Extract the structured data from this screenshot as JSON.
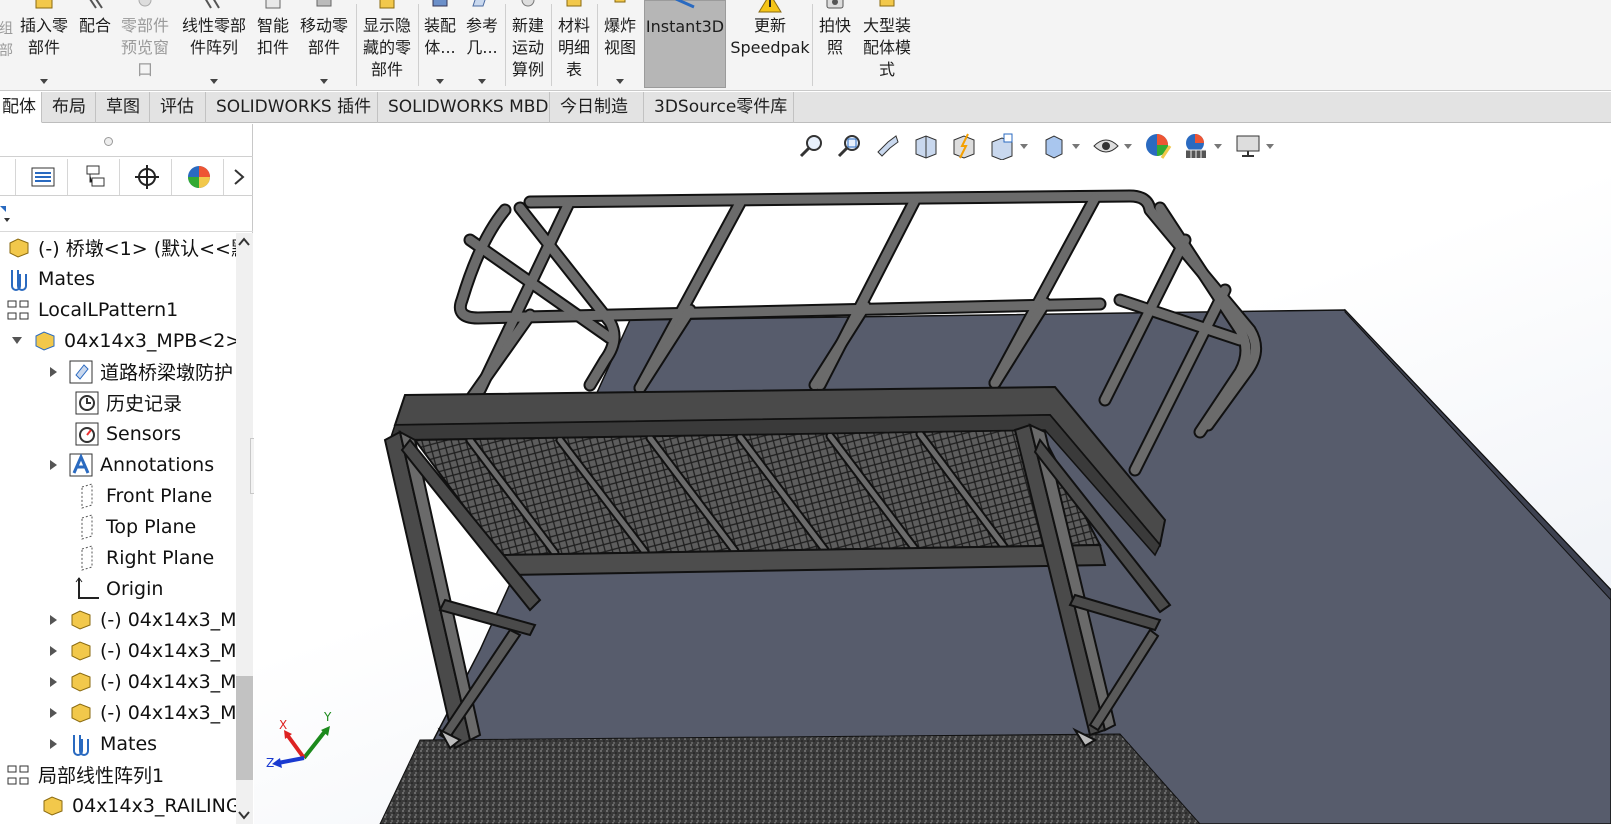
{
  "ribbon": {
    "buttons": [
      {
        "label": "插入零\n部件"
      },
      {
        "label": "配合"
      },
      {
        "label": "零部件\n预览窗\n口"
      },
      {
        "label": "线性零部\n件阵列"
      },
      {
        "label": "智能\n扣件"
      },
      {
        "label": "移动零\n部件"
      },
      {
        "label": "显示隐\n藏的零\n部件"
      },
      {
        "label": "装配\n体..."
      },
      {
        "label": "参考\n几..."
      },
      {
        "label": "新建\n运动\n算例"
      },
      {
        "label": "材料\n明细\n表"
      },
      {
        "label": "爆炸\n视图"
      },
      {
        "label": "Instant3D"
      },
      {
        "label": "更新\nSpeedpak"
      },
      {
        "label": "拍快\n照"
      },
      {
        "label": "大型装\n配体模\n式"
      }
    ],
    "left_edge_text": "组\n部"
  },
  "tabs": [
    {
      "label": "配体"
    },
    {
      "label": "布局"
    },
    {
      "label": "草图"
    },
    {
      "label": "评估"
    },
    {
      "label": "SOLIDWORKS 插件"
    },
    {
      "label": "SOLIDWORKS MBD"
    },
    {
      "label": "今日制造"
    },
    {
      "label": "3DSource零件库"
    }
  ],
  "tree": {
    "items": [
      {
        "label": "(-) 桥墩<1> (默认<<默"
      },
      {
        "label": "Mates"
      },
      {
        "label": "LocalLPattern1"
      },
      {
        "label": "04x14x3_MPB<2>"
      },
      {
        "label": "道路桥梁墩防护"
      },
      {
        "label": "历史记录"
      },
      {
        "label": "Sensors"
      },
      {
        "label": "Annotations"
      },
      {
        "label": "Front Plane"
      },
      {
        "label": "Top Plane"
      },
      {
        "label": "Right Plane"
      },
      {
        "label": "Origin"
      },
      {
        "label": "(-) 04x14x3_M"
      },
      {
        "label": "(-) 04x14x3_M"
      },
      {
        "label": "(-) 04x14x3_M"
      },
      {
        "label": "(-) 04x14x3_M"
      },
      {
        "label": "Mates"
      },
      {
        "label": "局部线性阵列1"
      },
      {
        "label": "04x14x3_RAILING"
      }
    ]
  },
  "triad": {
    "x": "X",
    "y": "Y",
    "z": "Z"
  },
  "colors": {
    "ribbon_bg": "#f4f4f4",
    "active_button": "#b6b6b6",
    "tabs_bg": "#e3e3e3",
    "slab": "#565b6b",
    "steel": "#4a4a4a",
    "ground": "#3a3a3a"
  }
}
